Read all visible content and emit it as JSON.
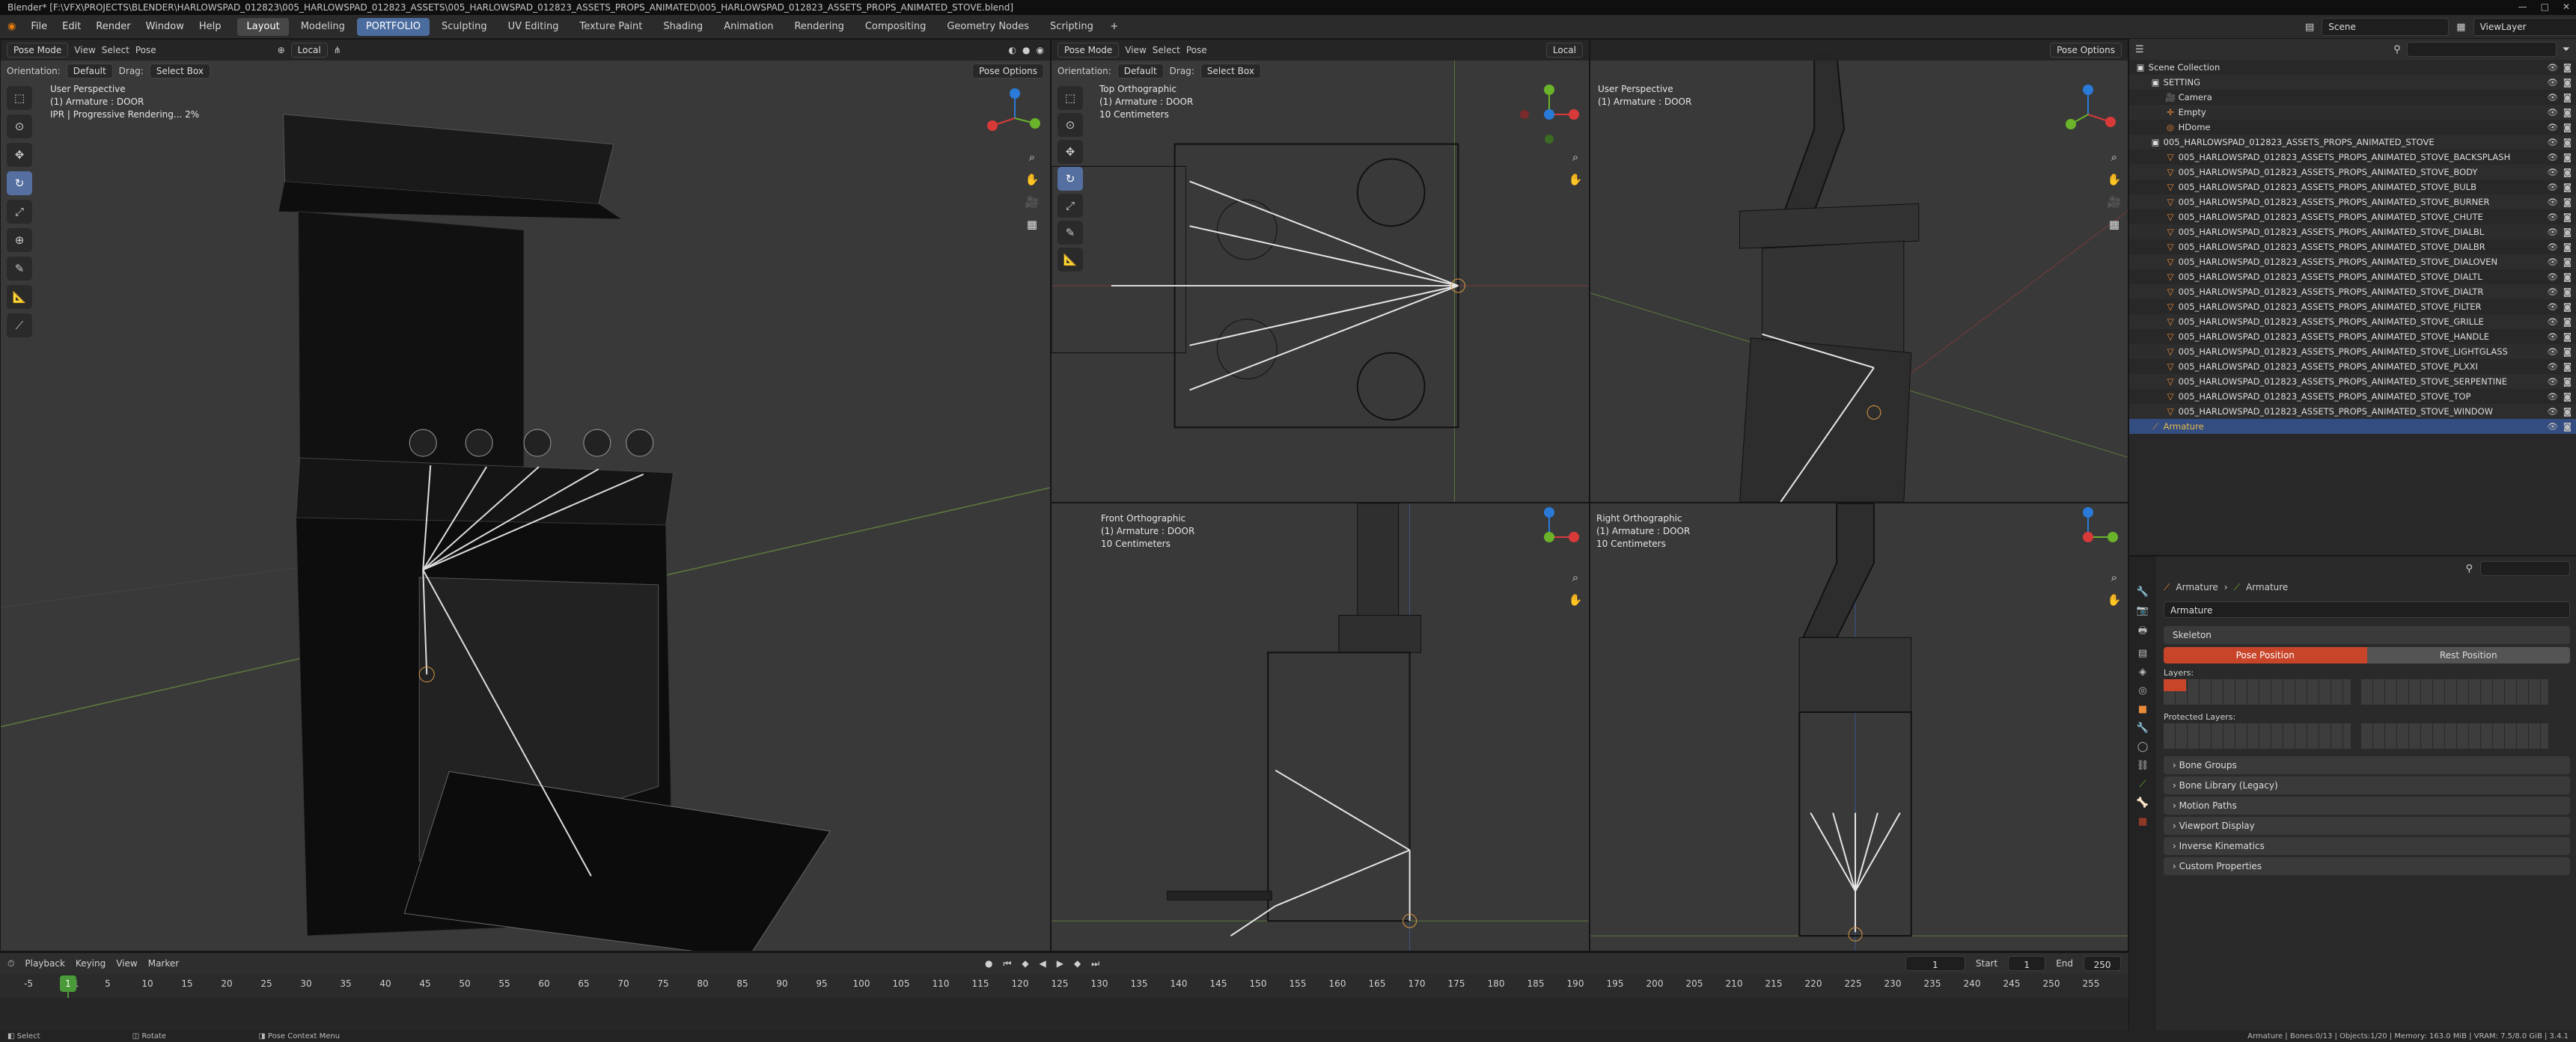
{
  "window": {
    "title": "Blender* [F:\\VFX\\PROJECTS\\BLENDER\\HARLOWSPAD_012823\\005_HARLOWSPAD_012823_ASSETS\\005_HARLOWSPAD_012823_ASSETS_PROPS_ANIMATED\\005_HARLOWSPAD_012823_ASSETS_PROPS_ANIMATED_STOVE.blend]"
  },
  "menu": [
    "File",
    "Edit",
    "Render",
    "Window",
    "Help"
  ],
  "workspaces": [
    "Layout",
    "Modeling",
    "PORTFOLIO",
    "Sculpting",
    "UV Editing",
    "Texture Paint",
    "Shading",
    "Animation",
    "Rendering",
    "Compositing",
    "Geometry Nodes",
    "Scripting"
  ],
  "scene": {
    "label": "Scene",
    "view_layer": "ViewLayer"
  },
  "vp_main": {
    "mode": "Pose Mode",
    "view": "View",
    "select": "Select",
    "pose": "Pose",
    "orientation_label": "Orientation:",
    "orientation": "Default",
    "drag_label": "Drag:",
    "drag": "Select Box",
    "pivot": "Local",
    "options": "Pose Options",
    "info1": "User Perspective",
    "info2": "(1) Armature : DOOR",
    "info3": "IPR | Progressive Rendering... 2%"
  },
  "vp_top": {
    "mode": "Pose Mode",
    "view": "View",
    "select": "Select",
    "pose": "Pose",
    "orientation_label": "Orientation:",
    "orientation": "Default",
    "drag_label": "Drag:",
    "drag": "Select Box",
    "pivot": "Local",
    "options": "Pose Options",
    "info1": "Top Orthographic",
    "info2": "(1) Armature : DOOR",
    "info3": "10 Centimeters"
  },
  "vp_persp2": {
    "options": "Pose Options",
    "info1": "User Perspective",
    "info2": "(1) Armature : DOOR"
  },
  "vp_front": {
    "info1": "Front Orthographic",
    "info2": "(1) Armature : DOOR",
    "info3": "10 Centimeters"
  },
  "vp_right": {
    "info1": "Right Orthographic",
    "info2": "(1) Armature : DOOR",
    "info3": "10 Centimeters"
  },
  "outliner": {
    "search_placeholder": "",
    "items": [
      {
        "label": "Scene Collection",
        "type": "collection"
      },
      {
        "label": "SETTING",
        "type": "collection"
      },
      {
        "label": "Camera",
        "type": "camera"
      },
      {
        "label": "Empty",
        "type": "empty"
      },
      {
        "label": "HDome",
        "type": "object"
      },
      {
        "label": "005_HARLOWSPAD_012823_ASSETS_PROPS_ANIMATED_STOVE",
        "type": "collection"
      },
      {
        "label": "005_HARLOWSPAD_012823_ASSETS_PROPS_ANIMATED_STOVE_BACKSPLASH",
        "type": "mesh"
      },
      {
        "label": "005_HARLOWSPAD_012823_ASSETS_PROPS_ANIMATED_STOVE_BODY",
        "type": "mesh"
      },
      {
        "label": "005_HARLOWSPAD_012823_ASSETS_PROPS_ANIMATED_STOVE_BULB",
        "type": "mesh"
      },
      {
        "label": "005_HARLOWSPAD_012823_ASSETS_PROPS_ANIMATED_STOVE_BURNER",
        "type": "mesh"
      },
      {
        "label": "005_HARLOWSPAD_012823_ASSETS_PROPS_ANIMATED_STOVE_CHUTE",
        "type": "mesh"
      },
      {
        "label": "005_HARLOWSPAD_012823_ASSETS_PROPS_ANIMATED_STOVE_DIALBL",
        "type": "mesh"
      },
      {
        "label": "005_HARLOWSPAD_012823_ASSETS_PROPS_ANIMATED_STOVE_DIALBR",
        "type": "mesh"
      },
      {
        "label": "005_HARLOWSPAD_012823_ASSETS_PROPS_ANIMATED_STOVE_DIALOVEN",
        "type": "mesh"
      },
      {
        "label": "005_HARLOWSPAD_012823_ASSETS_PROPS_ANIMATED_STOVE_DIALTL",
        "type": "mesh"
      },
      {
        "label": "005_HARLOWSPAD_012823_ASSETS_PROPS_ANIMATED_STOVE_DIALTR",
        "type": "mesh"
      },
      {
        "label": "005_HARLOWSPAD_012823_ASSETS_PROPS_ANIMATED_STOVE_FILTER",
        "type": "mesh"
      },
      {
        "label": "005_HARLOWSPAD_012823_ASSETS_PROPS_ANIMATED_STOVE_GRILLE",
        "type": "mesh"
      },
      {
        "label": "005_HARLOWSPAD_012823_ASSETS_PROPS_ANIMATED_STOVE_HANDLE",
        "type": "mesh"
      },
      {
        "label": "005_HARLOWSPAD_012823_ASSETS_PROPS_ANIMATED_STOVE_LIGHTGLASS",
        "type": "mesh"
      },
      {
        "label": "005_HARLOWSPAD_012823_ASSETS_PROPS_ANIMATED_STOVE_PLXXI",
        "type": "mesh"
      },
      {
        "label": "005_HARLOWSPAD_012823_ASSETS_PROPS_ANIMATED_STOVE_SERPENTINE",
        "type": "mesh"
      },
      {
        "label": "005_HARLOWSPAD_012823_ASSETS_PROPS_ANIMATED_STOVE_TOP",
        "type": "mesh"
      },
      {
        "label": "005_HARLOWSPAD_012823_ASSETS_PROPS_ANIMATED_STOVE_WINDOW",
        "type": "mesh"
      },
      {
        "label": "Armature",
        "type": "armature"
      }
    ]
  },
  "properties": {
    "breadcrumb": [
      "Armature",
      "Armature"
    ],
    "name": "Armature",
    "skeleton": "Skeleton",
    "pose_position": "Pose Position",
    "rest_position": "Rest Position",
    "layers": "Layers:",
    "protected_layers": "Protected Layers:",
    "sections": [
      "Bone Groups",
      "Bone Library (Legacy)",
      "Motion Paths",
      "Viewport Display",
      "Inverse Kinematics",
      "Custom Properties"
    ]
  },
  "timeline": {
    "menu": [
      "Playback",
      "Keying",
      "View",
      "Marker"
    ],
    "current_frame": "1",
    "start_label": "Start",
    "start": "1",
    "end_label": "End",
    "end": "250",
    "ticks": [
      "-5",
      "1",
      "5",
      "10",
      "15",
      "20",
      "25",
      "30",
      "35",
      "40",
      "45",
      "50",
      "55",
      "60",
      "65",
      "70",
      "75",
      "80",
      "85",
      "90",
      "95",
      "100",
      "105",
      "110",
      "115",
      "120",
      "125",
      "130",
      "135",
      "140",
      "145",
      "150",
      "155",
      "160",
      "165",
      "170",
      "175",
      "180",
      "185",
      "190",
      "195",
      "200",
      "205",
      "210",
      "215",
      "220",
      "225",
      "230",
      "235",
      "240",
      "245",
      "250",
      "255"
    ]
  },
  "status": {
    "select": "Select",
    "rotate": "Rotate",
    "context": "Pose Context Menu",
    "info": "Armature | Bones:0/13 | Objects:1/20 | Memory: 163.0 MiB | VRAM: 7.5/8.0 GiB | 3.4.1"
  },
  "colors": {
    "accent": "#4772b3",
    "active_bone": "#e8b84a",
    "red_button": "#c8452a",
    "outliner_icon": "#e88a3a"
  }
}
